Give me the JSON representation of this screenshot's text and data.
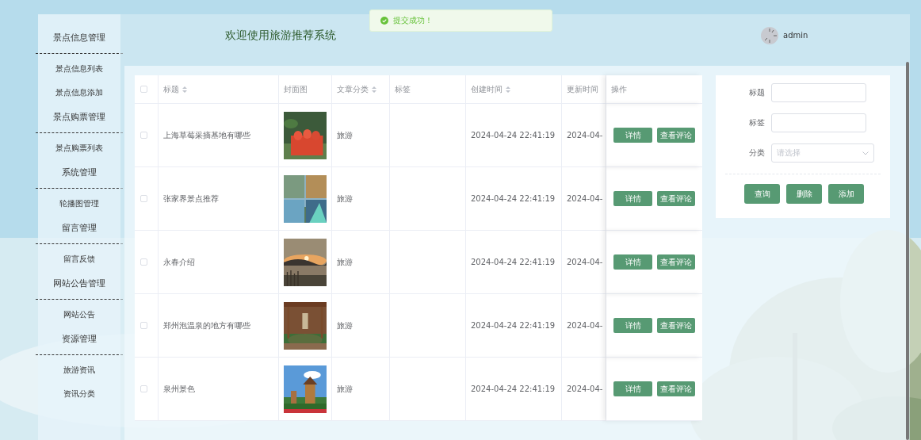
{
  "toast": {
    "text": "提交成功！"
  },
  "header": {
    "title": "欢迎使用旅游推荐系统",
    "user": "admin"
  },
  "sidebar": {
    "groups": [
      {
        "label": "景点信息管理",
        "children": [
          "景点信息列表",
          "景点信息添加"
        ]
      },
      {
        "label": "景点购票管理",
        "children": [
          "景点购票列表"
        ]
      },
      {
        "label": "系统管理",
        "children": [
          "轮播图管理"
        ]
      },
      {
        "label": "留言管理",
        "children": [
          "留言反馈"
        ]
      },
      {
        "label": "网站公告管理",
        "children": [
          "网站公告"
        ]
      },
      {
        "label": "资源管理",
        "children": [
          "旅游资讯",
          "资讯分类"
        ]
      }
    ]
  },
  "table": {
    "all_checked": false,
    "columns": [
      {
        "label": "标题",
        "sortable": true
      },
      {
        "label": "封面图",
        "sortable": false
      },
      {
        "label": "文章分类",
        "sortable": true
      },
      {
        "label": "标签",
        "sortable": false
      },
      {
        "label": "创建时间",
        "sortable": true
      },
      {
        "label": "更新时间"
      },
      {
        "label": "操作",
        "sortable": false
      }
    ],
    "rows": [
      {
        "checked": false,
        "title": "上海草莓采摘基地有哪些",
        "cover": {
          "kind": "picture"
        },
        "category": "旅游",
        "created": "2024-04-24 22:41:19",
        "updated": "2024-04-",
        "actions": [
          "详情",
          "查看评论"
        ]
      },
      {
        "checked": false,
        "title": "张家界景点推荐",
        "cover": {
          "kind": "picture"
        },
        "category": "旅游",
        "created": "2024-04-24 22:41:19",
        "updated": "2024-04-",
        "actions": [
          "详情",
          "查看评论"
        ]
      },
      {
        "checked": false,
        "title": "永春介绍",
        "cover": {
          "kind": "picture"
        },
        "category": "旅游",
        "created": "2024-04-24 22:41:19",
        "updated": "2024-04-",
        "actions": [
          "详情",
          "查看评论"
        ]
      },
      {
        "checked": false,
        "title": "郑州泡温泉的地方有哪些",
        "cover": {
          "kind": "picture"
        },
        "category": "旅游",
        "created": "2024-04-24 22:41:19",
        "updated": "2024-04-",
        "actions": [
          "详情",
          "查看评论"
        ]
      },
      {
        "checked": false,
        "title": "泉州景色",
        "cover": {
          "kind": "picture"
        },
        "category": "旅游",
        "created": "2024-04-24 22:41:19",
        "updated": "2024-04-",
        "actions": [
          "详情",
          "查看评论"
        ]
      }
    ]
  },
  "filter": {
    "fields": [
      {
        "label": "标题",
        "kind": "text"
      },
      {
        "label": "标签",
        "kind": "text"
      },
      {
        "label": "分类",
        "kind": "select",
        "placeholder": "请选择"
      }
    ],
    "buttons": [
      "查询",
      "删除",
      "添加"
    ]
  }
}
